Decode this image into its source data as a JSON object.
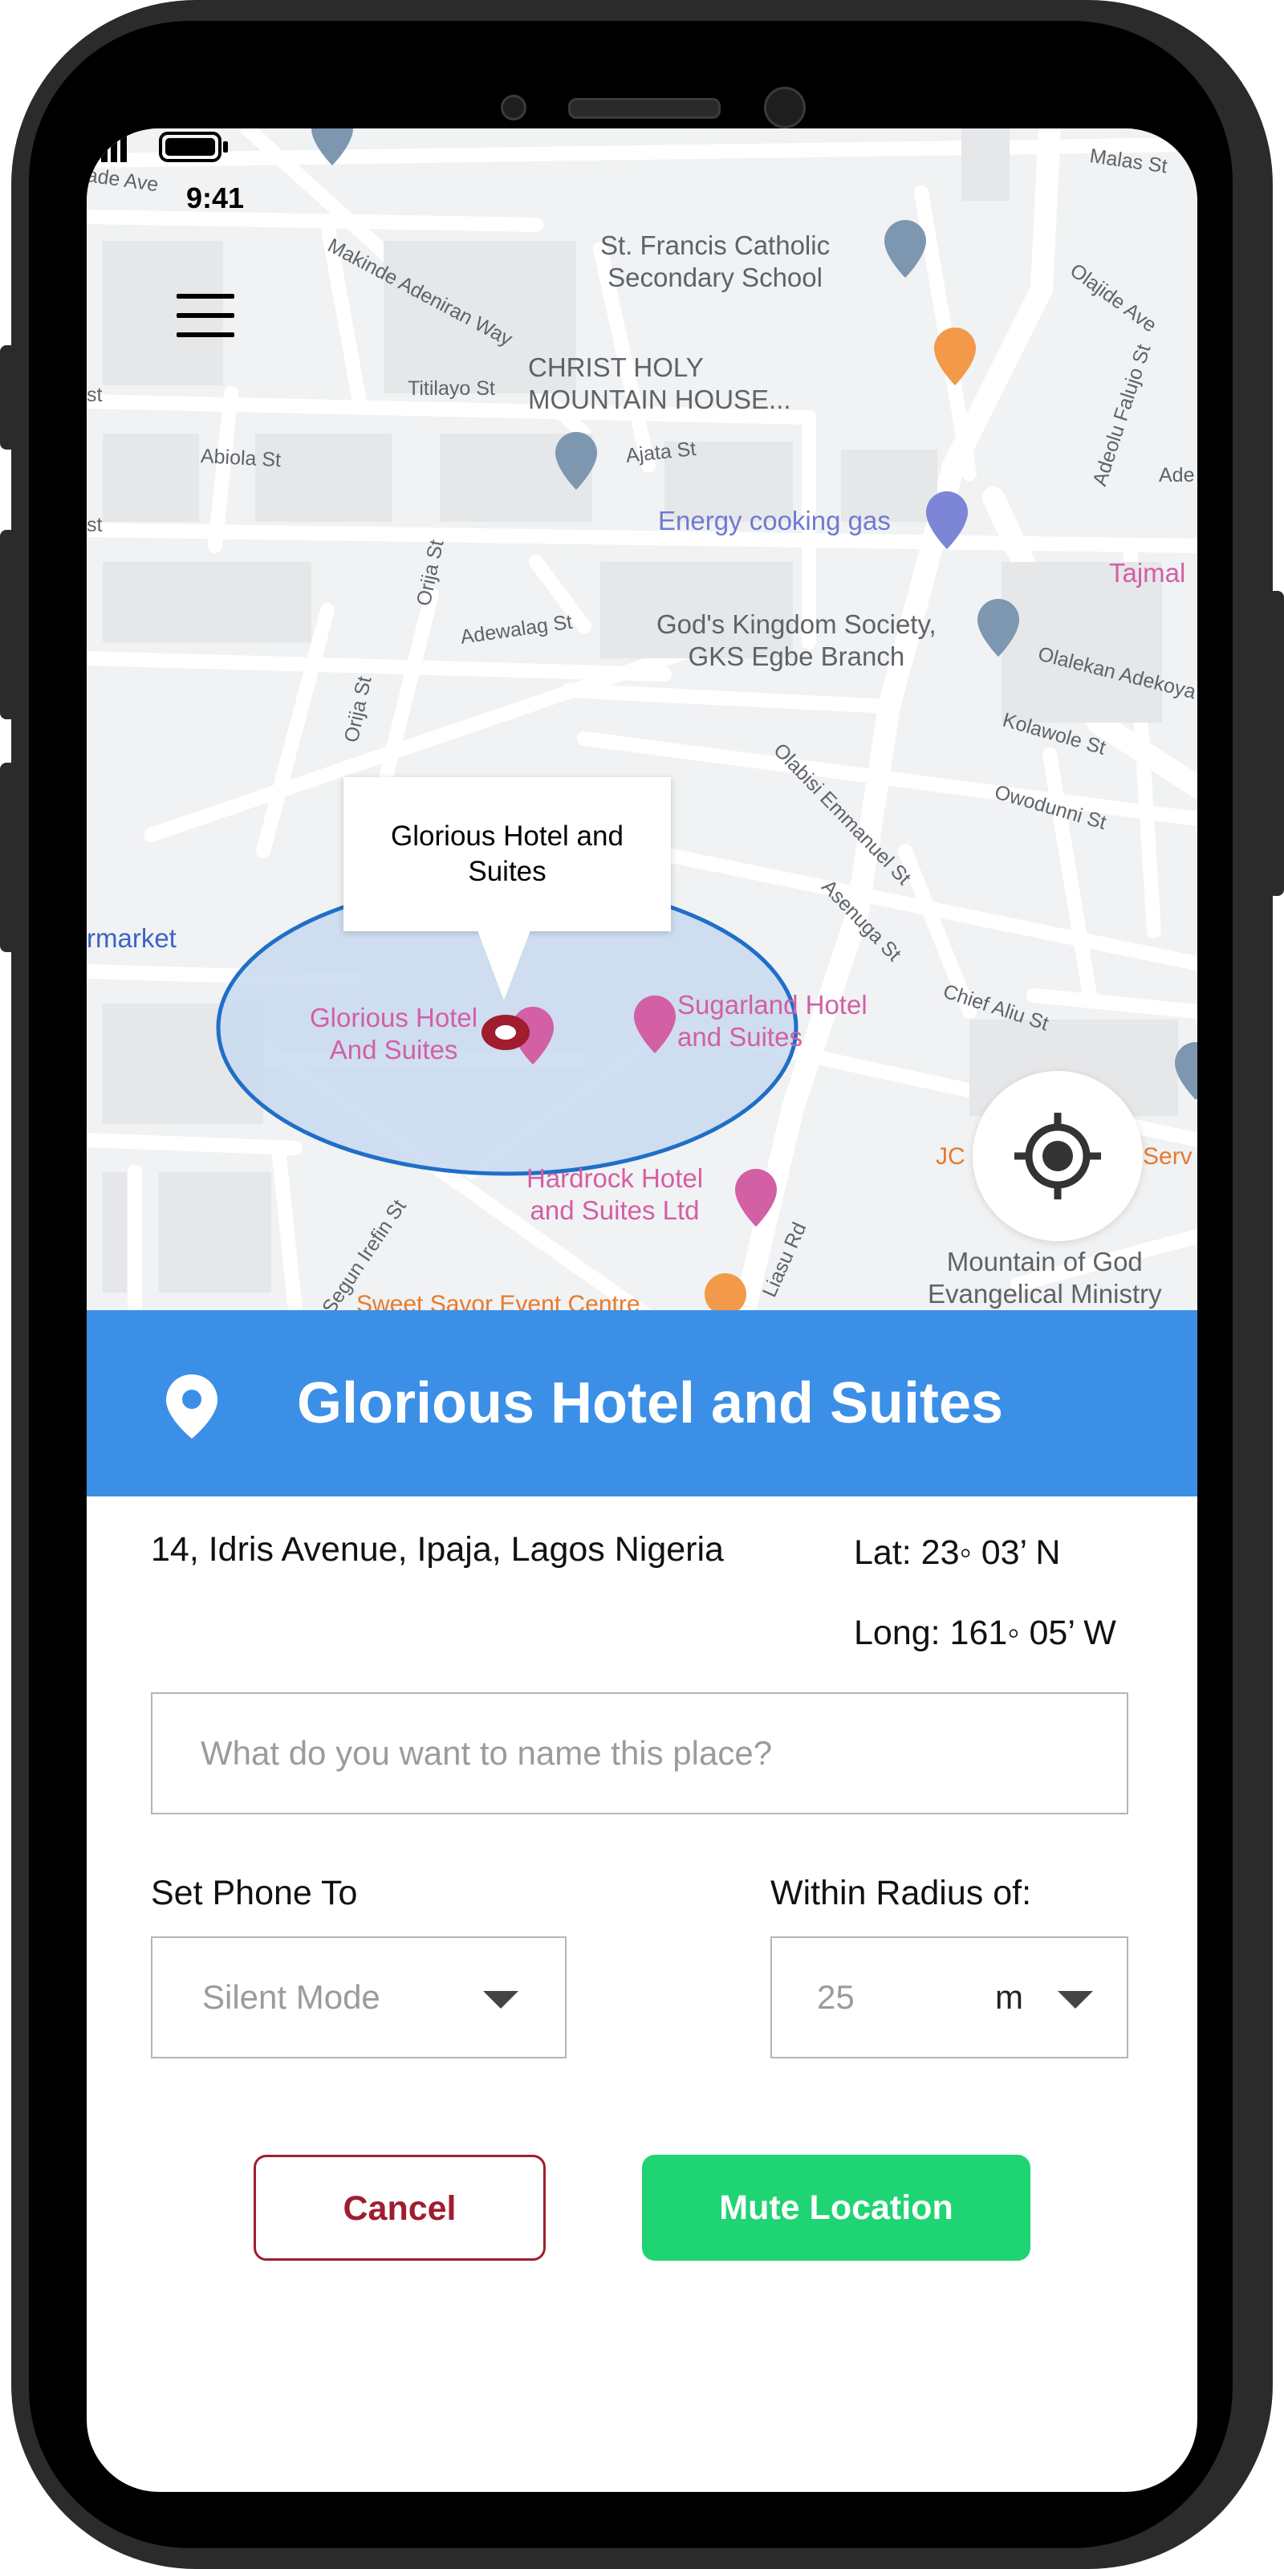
{
  "status_bar": {
    "time": "9:41"
  },
  "map": {
    "streets": [
      "ade Ave",
      "Makinde Adeniran Way",
      "Titilayo St",
      "Abiola St",
      "Orija St",
      "Orija St",
      "Adewalag St",
      "Ajata St",
      "Malas St",
      "Olajide Ave",
      "Adeolu Falujo St",
      "Ade",
      "Olalekan Adekoya",
      "Kolawole St",
      "Owodunni St",
      "Olabisi Emmanuel St",
      "Asenuga St",
      "Chief Aliu St",
      "Segun Irefin St",
      "Liasu Rd",
      "st",
      "st"
    ],
    "places": {
      "school": [
        "St. Francis Catholic",
        "Secondary School"
      ],
      "church1": [
        "CHRIST HOLY",
        "MOUNTAIN HOUSE..."
      ],
      "gas": "Energy cooking gas",
      "society": [
        "God's Kingdom Society,",
        "GKS Egbe Branch"
      ],
      "tajmal": "Tajmal",
      "market": "rmarket",
      "glorious": [
        "Glorious Hotel",
        "And Suites"
      ],
      "sugarland": [
        "Sugarland Hotel",
        "and Suites"
      ],
      "hardrock": [
        "Hardrock Hotel",
        "and Suites Ltd"
      ],
      "mountain": [
        "Mountain of God",
        "Evangelical Ministry"
      ],
      "sweet": "Sweet Savor Event Centre",
      "jc": "JC",
      "serv": "Serv"
    },
    "callout_title": "Glorious Hotel and Suites"
  },
  "location": {
    "name": "Glorious Hotel and Suites",
    "address": "14, Idris Avenue, Ipaja, Lagos Nigeria",
    "lat": "Lat: 23◦ 03’ N",
    "long": "Long: 161◦ 05’ W"
  },
  "form": {
    "name_placeholder": "What do you want to name this place?",
    "phone_label": "Set Phone To",
    "phone_value": "Silent Mode",
    "radius_label": "Within Radius of:",
    "radius_value": "25",
    "radius_unit": "m"
  },
  "buttons": {
    "cancel": "Cancel",
    "mute": "Mute Location"
  },
  "colors": {
    "accent_blue": "#3c8fe6",
    "mute_green": "#1fd472",
    "cancel_red": "#9f1d2e",
    "radius_fill": "#c8d9ef",
    "radius_stroke": "#1f6fc8",
    "pin_red": "#9f1d2e"
  },
  "icons": {
    "menu": "hamburger-icon",
    "locate": "crosshair-icon",
    "title_pin": "map-pin-icon"
  }
}
